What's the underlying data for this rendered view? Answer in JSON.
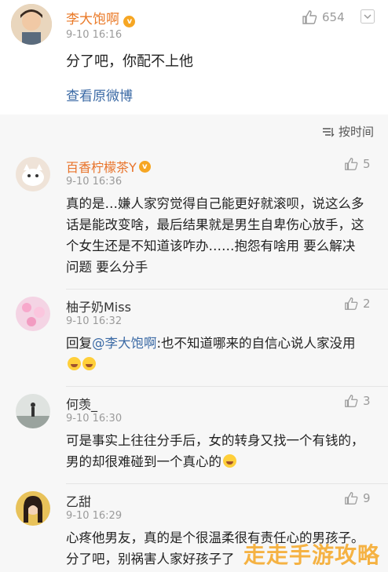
{
  "post": {
    "author": "李大饱啊",
    "time": "9-10 16:16",
    "likes": "654",
    "text": "分了吧，你配不上他",
    "view_original": "查看原微博"
  },
  "comments_header": {
    "sort_label": "按时间"
  },
  "comments": [
    {
      "name": "百香柠檬茶Y",
      "time": "9-10 16:36",
      "likes": "5",
      "text": "真的是…嫌人家穷觉得自己能更好就滚呗，说这么多话是能改变啥，最后结果就是男生自卑伤心放手，这个女生还是不知道该咋办……抱怨有啥用 要么解决问题 要么分手"
    },
    {
      "name": "柚子奶Miss",
      "time": "9-10 16:32",
      "likes": "2",
      "reply_prefix": "回复",
      "mention": "@李大饱啊",
      "text": ":也不知道哪来的自信心说人家没用"
    },
    {
      "name": "何羡_",
      "time": "9-10 16:30",
      "likes": "3",
      "text": "可是事实上往往分手后，女的转身又找一个有钱的，男的却很难碰到一个真心的"
    },
    {
      "name": "乙甜",
      "time": "9-10 16:29",
      "likes": "9",
      "text": "心疼他男友，真的是个很温柔很有责任心的男孩子。分了吧，别祸害人家好孩子了"
    }
  ],
  "watermark": "走走手游攻略",
  "colors": {
    "accent_name": "#ea7a28",
    "link": "#3b6aa5",
    "meta_gray": "#9b9b9b",
    "comments_bg": "#f7f7f7"
  }
}
